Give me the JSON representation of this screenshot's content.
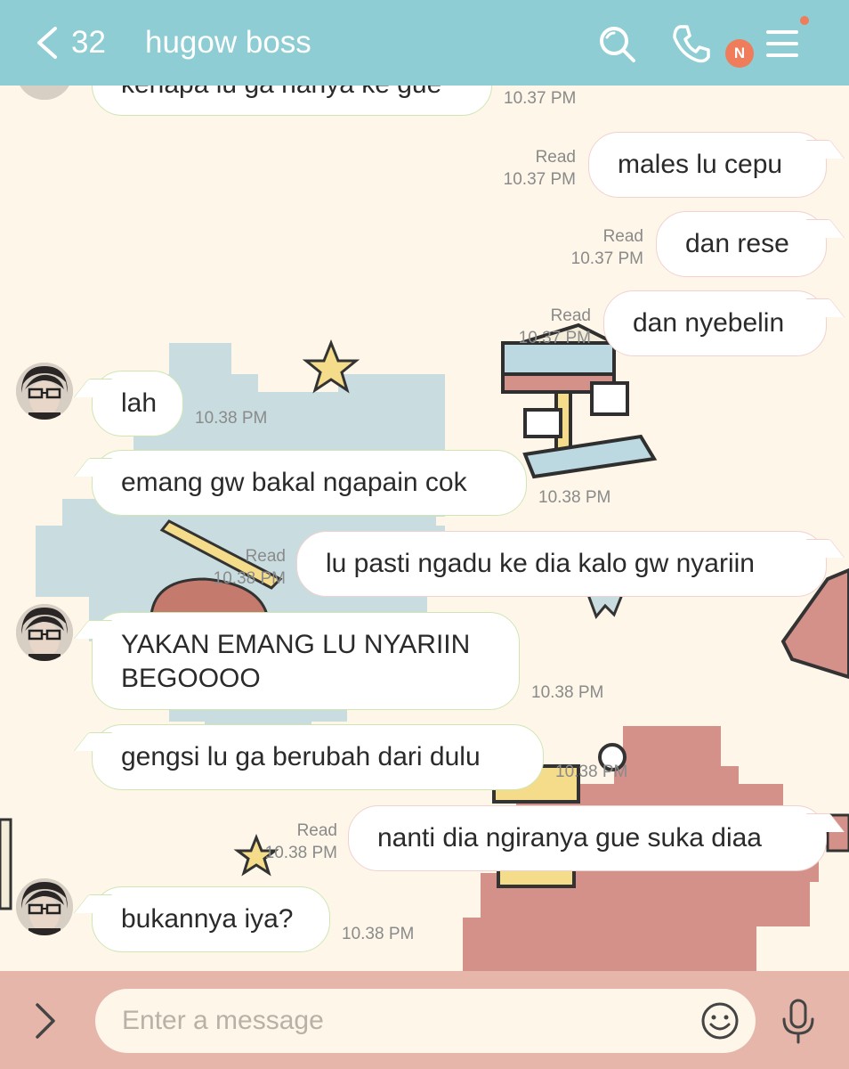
{
  "header": {
    "back_count": "32",
    "title": "hugow boss",
    "icons": [
      "chevron-left-icon",
      "search-icon",
      "phone-icon",
      "notes-badge-icon",
      "menu-icon"
    ],
    "badge_letter": "N",
    "colors": {
      "bar": "#8ecdd3",
      "badge": "#ef7c5a"
    }
  },
  "messages": [
    {
      "side": "in",
      "text": "kenapa lu ga nanya ke gue",
      "time": "10.37 PM",
      "avatar": false
    },
    {
      "side": "out",
      "text": "males lu cepu",
      "read": "Read",
      "time": "10.37 PM"
    },
    {
      "side": "out",
      "text": "dan rese",
      "read": "Read",
      "time": "10.37 PM"
    },
    {
      "side": "out",
      "text": "dan nyebelin",
      "read": "Read",
      "time": "10.37 PM"
    },
    {
      "side": "in",
      "text": "lah",
      "time": "10.38 PM",
      "avatar": true
    },
    {
      "side": "in",
      "text": "emang gw bakal ngapain cok",
      "time": "10.38 PM",
      "avatar": false
    },
    {
      "side": "out",
      "text": "lu pasti ngadu ke dia kalo gw nyariin",
      "read": "Read",
      "time": "10.38 PM"
    },
    {
      "side": "in",
      "text": "YAKAN EMANG LU NYARIIN BEGOOOO",
      "time": "10.38 PM",
      "avatar": true
    },
    {
      "side": "in",
      "text": "gengsi lu ga berubah dari dulu",
      "time": "10.38 PM",
      "avatar": false
    },
    {
      "side": "out",
      "text": "nanti dia ngiranya gue suka diaa",
      "read": "Read",
      "time": "10.38 PM"
    },
    {
      "side": "in",
      "text": "bukannya iya?",
      "time": "10.38 PM",
      "avatar": true
    }
  ],
  "input": {
    "placeholder": "Enter a message",
    "icons": [
      "chevron-right-icon",
      "emoji-icon",
      "microphone-icon"
    ],
    "bar_color": "#e6b6aa"
  }
}
